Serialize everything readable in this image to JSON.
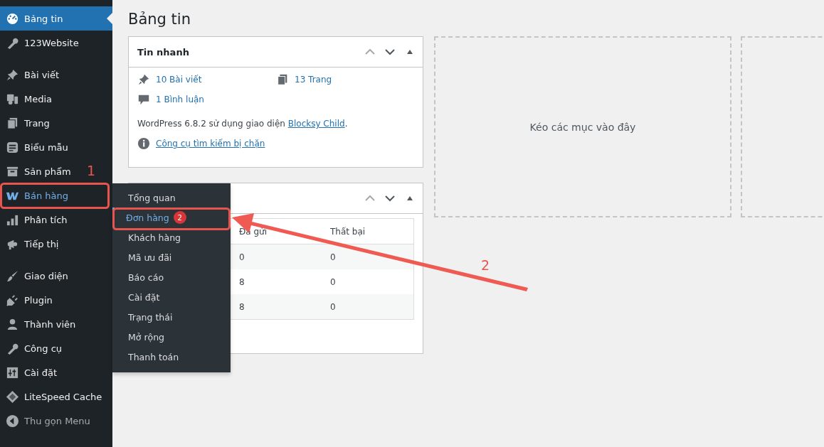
{
  "sidebar": {
    "groups": [
      [
        {
          "label": "Bảng tin",
          "selected": true,
          "open": false
        },
        {
          "label": "123Website",
          "selected": false,
          "open": false
        }
      ],
      [
        {
          "label": "Bài viết",
          "selected": false,
          "open": false
        },
        {
          "label": "Media",
          "selected": false,
          "open": false
        },
        {
          "label": "Trang",
          "selected": false,
          "open": false
        },
        {
          "label": "Biểu mẫu",
          "selected": false,
          "open": false
        },
        {
          "label": "Sản phẩm",
          "selected": false,
          "open": false
        },
        {
          "label": "Bán hàng",
          "selected": false,
          "open": true
        },
        {
          "label": "Phân tích",
          "selected": false,
          "open": false
        },
        {
          "label": "Tiếp thị",
          "selected": false,
          "open": false
        }
      ],
      [
        {
          "label": "Giao diện",
          "selected": false,
          "open": false
        },
        {
          "label": "Plugin",
          "selected": false,
          "open": false
        },
        {
          "label": "Thành viên",
          "selected": false,
          "open": false
        },
        {
          "label": "Công cụ",
          "selected": false,
          "open": false
        },
        {
          "label": "Cài đặt",
          "selected": false,
          "open": false
        },
        {
          "label": "LiteSpeed Cache",
          "selected": false,
          "open": false
        }
      ]
    ],
    "collapse_label": "Thu gọn Menu"
  },
  "submenu": {
    "items": [
      {
        "label": "Tổng quan",
        "selected": false
      },
      {
        "label": "Đơn hàng",
        "selected": true,
        "badge": "2"
      },
      {
        "label": "Khách hàng",
        "selected": false
      },
      {
        "label": "Mã ưu đãi",
        "selected": false
      },
      {
        "label": "Báo cáo",
        "selected": false
      },
      {
        "label": "Cài đặt",
        "selected": false
      },
      {
        "label": "Trạng thái",
        "selected": false
      },
      {
        "label": "Mở rộng",
        "selected": false
      },
      {
        "label": "Thanh toán",
        "selected": false
      }
    ]
  },
  "page_title": "Bảng tin",
  "at_a_glance": {
    "title": "Tin nhanh",
    "stats": [
      {
        "label": "10 Bài viết"
      },
      {
        "label": "13 Trang"
      },
      {
        "label": "1 Bình luận"
      }
    ],
    "version": {
      "text": "WordPress 6.8.2 sử dụng giao diện",
      "theme_link": "Blocksy Child",
      "after": "."
    },
    "notice_link": "Công cụ tìm kiếm bị chặn"
  },
  "second_widget": {
    "table": {
      "columns": [
        "Đã gửi",
        "Thất bại"
      ],
      "rows": [
        [
          "0",
          "0"
        ],
        [
          "8",
          "0"
        ],
        [
          "8",
          "0"
        ]
      ]
    }
  },
  "drop_zone": {
    "label": "Kéo các mục vào đây"
  },
  "annotations": {
    "labels": [
      "1",
      "2"
    ]
  }
}
